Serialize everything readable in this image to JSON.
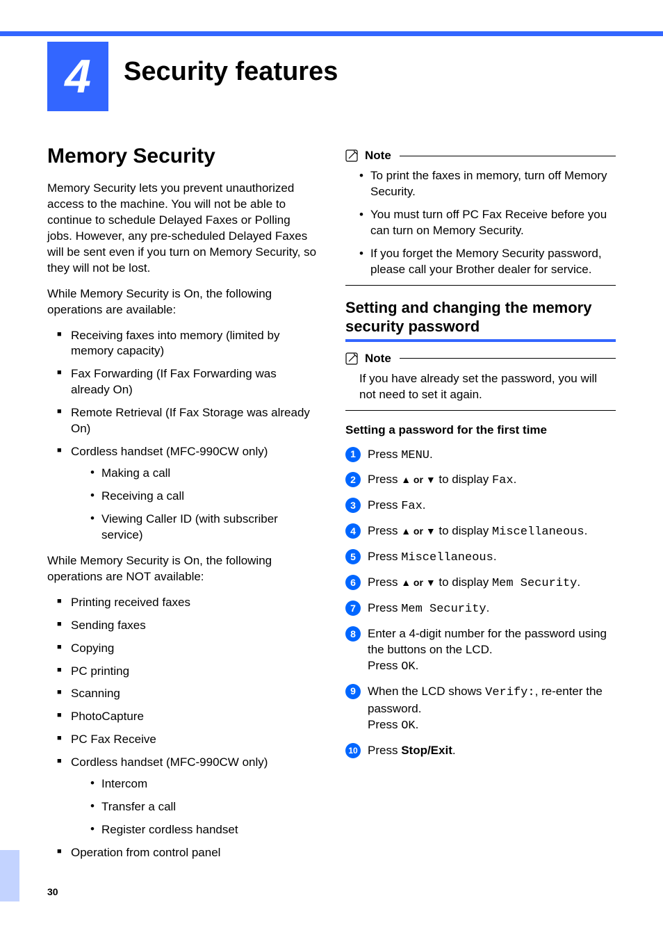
{
  "chapter": {
    "number": "4",
    "title": "Security features"
  },
  "page_number": "30",
  "left": {
    "heading": "Memory Security",
    "para1": "Memory Security lets you prevent unauthorized access to the machine. You will not be able to continue to schedule Delayed Faxes or Polling jobs. However, any pre-scheduled Delayed Faxes will be sent even if you turn on Memory Security, so they will not be lost.",
    "para2": "While Memory Security is On, the following operations are available:",
    "avail": {
      "0": "Receiving faxes into memory (limited by memory capacity)",
      "1": "Fax Forwarding (If Fax Forwarding was already On)",
      "2": "Remote Retrieval (If Fax Storage was already On)",
      "3": "Cordless handset (MFC-990CW only)",
      "sub3": {
        "0": "Making a call",
        "1": "Receiving a call",
        "2": "Viewing Caller ID (with subscriber service)"
      }
    },
    "para3": "While Memory Security is On, the following operations are NOT available:",
    "notavail": {
      "0": "Printing received faxes",
      "1": "Sending faxes",
      "2": "Copying",
      "3": "PC printing",
      "4": "Scanning",
      "5": "PhotoCapture",
      "6": "PC Fax Receive",
      "7": "Cordless handset (MFC-990CW only)",
      "sub7": {
        "0": "Intercom",
        "1": "Transfer a call",
        "2": "Register cordless handset"
      },
      "8": "Operation from control panel"
    }
  },
  "right": {
    "note1": {
      "label": "Note",
      "items": {
        "0": "To print the faxes in memory, turn off Memory Security.",
        "1": "You must turn off PC Fax Receive before you can turn on Memory Security.",
        "2": "If you forget the Memory Security password, please call your Brother dealer for service."
      }
    },
    "subheading": "Setting and changing the memory security password",
    "note2": {
      "label": "Note",
      "text": "If you have already set the password, you will not need to set it again."
    },
    "proc_head": "Setting a password for the first time",
    "steps": {
      "1": {
        "pre": "Press ",
        "tt": "MENU",
        "post": "."
      },
      "2": {
        "pre": "Press ",
        "arrows": "▲ or ▼",
        "mid": " to display ",
        "tt": "Fax",
        "post": "."
      },
      "3": {
        "pre": "Press ",
        "tt": "Fax",
        "post": "."
      },
      "4": {
        "pre": "Press ",
        "arrows": "▲ or ▼",
        "mid": " to display ",
        "tt": "Miscellaneous",
        "post": "."
      },
      "5": {
        "pre": "Press ",
        "tt": "Miscellaneous",
        "post": "."
      },
      "6": {
        "pre": "Press ",
        "arrows": "▲ or ▼",
        "mid": " to display ",
        "tt": "Mem Security",
        "post": "."
      },
      "7": {
        "pre": "Press ",
        "tt": "Mem Security",
        "post": "."
      },
      "8": {
        "l1": "Enter a 4-digit number for the password using the buttons on the LCD.",
        "l2pre": "Press ",
        "l2tt": "OK",
        "l2post": "."
      },
      "9": {
        "l1pre": "When the LCD shows ",
        "l1tt": "Verify:",
        "l1post": ", re-enter the password.",
        "l2pre": "Press ",
        "l2tt": "OK",
        "l2post": "."
      },
      "10": {
        "pre": "Press ",
        "bold": "Stop/Exit",
        "post": "."
      }
    }
  }
}
